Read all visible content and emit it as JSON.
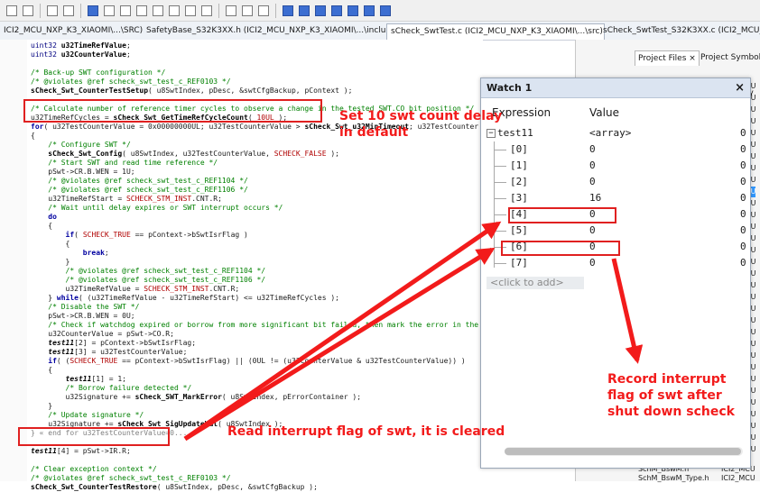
{
  "tabs": [
    {
      "label": "ICI2_MCU_NXP_K3_XIAOMI\\...\\SRC)",
      "active": false
    },
    {
      "label": "SafetyBase_S32K3XX.h (ICI2_MCU_NXP_K3_XIAOMI\\...\\include)",
      "active": false
    },
    {
      "label": "sCheck_SwtTest.c (ICI2_MCU_NXP_K3_XIAOMI\\...\\src)",
      "active": true,
      "close": "×"
    },
    {
      "label": "sCheck_SwtTest_S32K3XX.c (ICI2_MCU_NXP_K3_XIAOMI",
      "active": false
    }
  ],
  "project_panel": {
    "tab_files": "Project Files ×",
    "tab_symbols": "Project Symbols",
    "column_fragment": "y",
    "items": [
      "CU",
      "CU",
      "CU",
      "CU",
      "CU",
      "CU",
      "CU",
      "CU",
      "CU",
      "CU",
      "CU",
      "CU",
      "CU",
      "CU",
      "CU",
      "CU",
      "CU",
      "CU",
      "CU",
      "CU",
      "CU",
      "CU",
      "CU",
      "CU",
      "CU",
      "CU",
      "CU",
      "CU",
      "CU",
      "CU",
      "CU",
      "CU"
    ],
    "selected_index": 9,
    "bottom_files": [
      {
        "name": "SchM_BswM.h",
        "project": "ICI2_MCU"
      },
      {
        "name": "SchM_BswM_Type.h",
        "project": "ICI2_MCU"
      }
    ]
  },
  "code_lines": [
    {
      "n": "",
      "t": [
        [
          "c-type",
          "uint32 "
        ],
        [
          "c-func",
          "u32TimeRefValue"
        ],
        [
          "code",
          ";"
        ]
      ]
    },
    {
      "n": "",
      "t": [
        [
          "c-type",
          "uint32 "
        ],
        [
          "c-func",
          "u32CounterValue"
        ],
        [
          "code",
          ";"
        ]
      ]
    },
    {
      "n": "",
      "t": [
        [
          "code",
          ""
        ]
      ]
    },
    {
      "n": "",
      "t": [
        [
          "c-comment",
          "/* Back-up SWT configuration */"
        ]
      ]
    },
    {
      "n": "",
      "t": [
        [
          "c-comment",
          "/* @violates @ref scheck_swt_test_c_REF0103 */"
        ]
      ]
    },
    {
      "n": "",
      "t": [
        [
          "c-func",
          "sCheck_Swt_CounterTestSetup"
        ],
        [
          "code",
          "( u8SwtIndex, pDesc, &swtCfgBackup, pContext );"
        ]
      ]
    },
    {
      "n": "",
      "t": [
        [
          "code",
          ""
        ]
      ]
    },
    {
      "n": "",
      "t": [
        [
          "c-comment",
          "/* Calculate number of reference timer cycles to observe a change in the tested SWT.CO bit position */"
        ]
      ]
    },
    {
      "n": "",
      "t": [
        [
          "code",
          "u32TimeRefCycles = "
        ],
        [
          "c-func",
          "sCheck_Swt_GetTimeRefCycleCount"
        ],
        [
          "code",
          "( "
        ],
        [
          "c-macro",
          "10UL"
        ],
        [
          "code",
          " );"
        ]
      ]
    },
    {
      "n": "",
      "t": [
        [
          "c-kw",
          "for"
        ],
        [
          "code",
          "( u32TestCounterValue = 0x00000000UL; u32TestCounterValue > "
        ],
        [
          "c-func",
          "sCheck_Swt_u32MinTimeout"
        ],
        [
          "code",
          "; u32TestCounter"
        ]
      ]
    },
    {
      "n": "",
      "t": [
        [
          "code",
          "{"
        ]
      ]
    },
    {
      "n": "",
      "t": [
        [
          "c-comment",
          "    /* Configure SWT */"
        ]
      ]
    },
    {
      "n": "",
      "t": [
        [
          "c-func",
          "    sCheck_Swt_Config"
        ],
        [
          "code",
          "( u8SwtIndex, u32TestCounterValue, "
        ],
        [
          "c-macro",
          "SCHECK_FALSE"
        ],
        [
          "code",
          " );"
        ]
      ]
    },
    {
      "n": "",
      "t": [
        [
          "c-comment",
          "    /* Start SWT and read time reference */"
        ]
      ]
    },
    {
      "n": "",
      "t": [
        [
          "code",
          "    pSwt->CR.B.WEN = 1U;"
        ]
      ]
    },
    {
      "n": "",
      "t": [
        [
          "c-comment",
          "    /* @violates @ref scheck_swt_test_c_REF1104 */"
        ]
      ]
    },
    {
      "n": "",
      "t": [
        [
          "c-comment",
          "    /* @violates @ref scheck_swt_test_c_REF1106 */"
        ]
      ]
    },
    {
      "n": "",
      "t": [
        [
          "code",
          "    u32TimeRefStart = "
        ],
        [
          "c-macro",
          "SCHECK_STM_INST"
        ],
        [
          "code",
          ".CNT.R;"
        ]
      ]
    },
    {
      "n": "",
      "t": [
        [
          "c-comment",
          "    /* Wait until delay expires or SWT interrupt occurs */"
        ]
      ]
    },
    {
      "n": "",
      "t": [
        [
          "c-kw",
          "    do"
        ]
      ]
    },
    {
      "n": "",
      "t": [
        [
          "code",
          "    {"
        ]
      ]
    },
    {
      "n": "",
      "t": [
        [
          "c-kw",
          "        if"
        ],
        [
          "code",
          "( "
        ],
        [
          "c-macro",
          "SCHECK_TRUE"
        ],
        [
          "code",
          " == pContext->bSwtIsrFlag )"
        ]
      ]
    },
    {
      "n": "",
      "t": [
        [
          "code",
          "        {"
        ]
      ]
    },
    {
      "n": "",
      "t": [
        [
          "c-kw",
          "            break"
        ],
        [
          "code",
          ";"
        ]
      ]
    },
    {
      "n": "",
      "t": [
        [
          "code",
          "        }"
        ]
      ]
    },
    {
      "n": "",
      "t": [
        [
          "c-comment",
          "        /* @violates @ref scheck_swt_test_c_REF1104 */"
        ]
      ]
    },
    {
      "n": "",
      "t": [
        [
          "c-comment",
          "        /* @violates @ref scheck_swt_test_c_REF1106 */"
        ]
      ]
    },
    {
      "n": "",
      "t": [
        [
          "code",
          "        u32TimeRefValue = "
        ],
        [
          "c-macro",
          "SCHECK_STM_INST"
        ],
        [
          "code",
          ".CNT.R;"
        ]
      ]
    },
    {
      "n": "",
      "t": [
        [
          "code",
          "    } "
        ],
        [
          "c-kw",
          "while"
        ],
        [
          "code",
          "( (u32TimeRefValue - u32TimeRefStart) <= u32TimeRefCycles );"
        ]
      ]
    },
    {
      "n": "",
      "t": [
        [
          "c-comment",
          "    /* Disable the SWT */"
        ]
      ]
    },
    {
      "n": "",
      "t": [
        [
          "code",
          "    pSwt->CR.B.WEN = 0U;"
        ]
      ]
    },
    {
      "n": "",
      "t": [
        [
          "c-comment",
          "    /* Check if watchdog expired or borrow from more significant bit failed, then mark the error in the"
        ]
      ]
    },
    {
      "n": "",
      "t": [
        [
          "code",
          "    u32CounterValue = pSwt->CO.R;"
        ]
      ]
    },
    {
      "n": "",
      "t": [
        [
          "c-var",
          "    test11"
        ],
        [
          "code",
          "[2] = pContext->bSwtIsrFlag;"
        ]
      ]
    },
    {
      "n": "",
      "t": [
        [
          "c-var",
          "    test11"
        ],
        [
          "code",
          "[3] = u32TestCounterValue;"
        ]
      ]
    },
    {
      "n": "",
      "t": [
        [
          "c-kw",
          "    if"
        ],
        [
          "code",
          "( ("
        ],
        [
          "c-macro",
          "SCHECK_TRUE"
        ],
        [
          "code",
          " == pContext->bSwtIsrFlag) || (0UL != (u32CounterValue & u32TestCounterValue)) )"
        ]
      ]
    },
    {
      "n": "",
      "t": [
        [
          "code",
          "    {"
        ]
      ]
    },
    {
      "n": "",
      "t": [
        [
          "c-var",
          "        test11"
        ],
        [
          "code",
          "[1] = 1;"
        ]
      ]
    },
    {
      "n": "",
      "t": [
        [
          "c-comment",
          "        /* Borrow failure detected */"
        ]
      ]
    },
    {
      "n": "",
      "t": [
        [
          "code",
          "        u32Signature += "
        ],
        [
          "c-func",
          "sCheck_SWT_MarkError"
        ],
        [
          "code",
          "( u8SwtIndex, pErrorContainer );"
        ]
      ]
    },
    {
      "n": "",
      "t": [
        [
          "code",
          "    }"
        ]
      ]
    },
    {
      "n": "",
      "t": [
        [
          "c-comment",
          "    /* Update signature */"
        ]
      ]
    },
    {
      "n": "",
      "t": [
        [
          "code",
          "    u32Signature += "
        ],
        [
          "c-func",
          "sCheck_Swt_SigUpdateVal"
        ],
        [
          "code",
          "( u8SwtIndex );"
        ]
      ]
    },
    {
      "n": "",
      "t": [
        [
          "c-fold",
          "} « end for u32TestCounterValue=0... »"
        ]
      ]
    },
    {
      "n": "",
      "t": [
        [
          "code",
          ""
        ]
      ]
    },
    {
      "n": "",
      "t": [
        [
          "c-var",
          "test11"
        ],
        [
          "code",
          "[4] = pSwt->IR.R;"
        ]
      ]
    },
    {
      "n": "",
      "t": [
        [
          "code",
          ""
        ]
      ]
    },
    {
      "n": "",
      "t": [
        [
          "c-comment",
          "/* Clear exception context */"
        ]
      ]
    },
    {
      "n": "",
      "t": [
        [
          "c-comment",
          "/* @violates @ref scheck_swt_test_c_REF0103 */"
        ]
      ]
    },
    {
      "n": "",
      "t": [
        [
          "c-func",
          "sCheck_Swt_CounterTestRestore"
        ],
        [
          "code",
          "( u8SwtIndex, pDesc, &swtCfgBackup );"
        ]
      ]
    }
  ],
  "watch": {
    "title": "Watch 1",
    "close": "×",
    "col_expression": "Expression",
    "col_value": "Value",
    "root": {
      "expr": "test11",
      "value": "<array>",
      "type": "0"
    },
    "items": [
      {
        "expr": "[0]",
        "value": "0",
        "type": "0"
      },
      {
        "expr": "[1]",
        "value": "0",
        "type": "0"
      },
      {
        "expr": "[2]",
        "value": "0",
        "type": "0"
      },
      {
        "expr": "[3]",
        "value": "16",
        "type": "0"
      },
      {
        "expr": "[4]",
        "value": "0",
        "type": "0"
      },
      {
        "expr": "[5]",
        "value": "0",
        "type": "0"
      },
      {
        "expr": "[6]",
        "value": "0",
        "type": "0"
      },
      {
        "expr": "[7]",
        "value": "0",
        "type": "0"
      }
    ],
    "add_placeholder": "<click to add>"
  },
  "annotations": {
    "set10": "Set 10 swt count delay in default",
    "read_flag": "Read interrupt flag of swt, it is cleared",
    "record_flag": "Record interrupt flag of swt after shut down scheck"
  },
  "colors": {
    "annotation_red": "#f21b1b",
    "selection_blue": "#3399ff"
  }
}
